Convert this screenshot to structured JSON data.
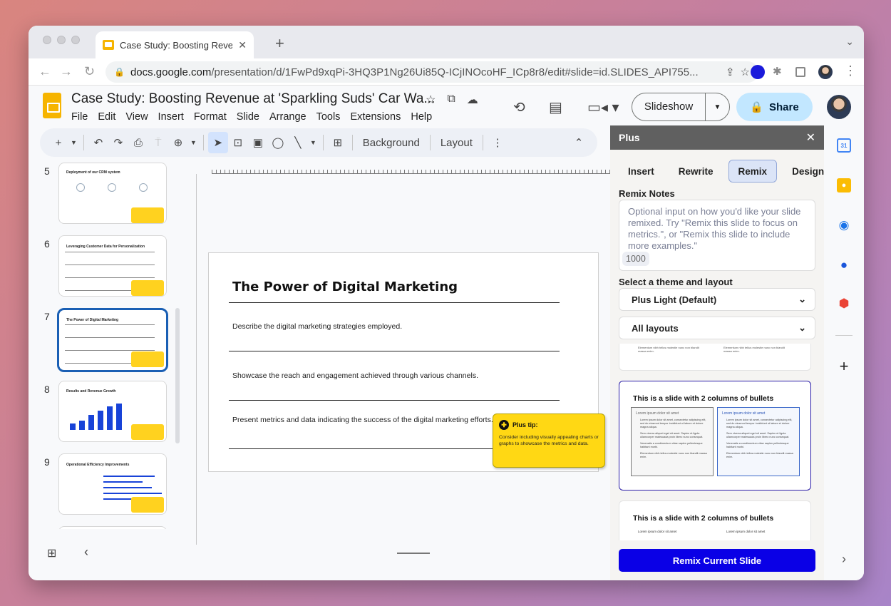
{
  "browser": {
    "tab_title": "Case Study: Boosting Revenue",
    "url_domain": "docs.google.com",
    "url_path": "/presentation/d/1FwPd9xqPi-3HQ3P1Ng26Ui85Q-ICjINOcoHF_ICp8r8/edit#slide=id.SLIDES_API755..."
  },
  "app": {
    "doc_title": "Case Study: Boosting Revenue at 'Sparkling Suds' Car Wa...",
    "menus": [
      "File",
      "Edit",
      "View",
      "Insert",
      "Format",
      "Slide",
      "Arrange",
      "Tools",
      "Extensions",
      "Help"
    ],
    "slideshow_label": "Slideshow",
    "share_label": "Share"
  },
  "toolbar": {
    "background_label": "Background",
    "layout_label": "Layout"
  },
  "filmstrip": {
    "slides": [
      {
        "number": "5",
        "title": "Deployment of our CRM system"
      },
      {
        "number": "6",
        "title": "Leveraging Customer Data for Personalization"
      },
      {
        "number": "7",
        "title": "The Power of Digital Marketing",
        "active": true
      },
      {
        "number": "8",
        "title": "Results and Revenue Growth"
      },
      {
        "number": "9",
        "title": "Operational Efficiency Improvements"
      }
    ]
  },
  "slide": {
    "title": "The Power of Digital Marketing",
    "bullets": [
      "Describe the digital marketing strategies employed.",
      "Showcase the reach and engagement achieved through various channels.",
      "Present metrics and data indicating the success of the digital marketing efforts."
    ],
    "tip": {
      "heading": "Plus tip:",
      "body": "Consider including visually appealing charts or graphs to showcase the metrics and data."
    }
  },
  "panel": {
    "title": "Plus",
    "tabs": [
      "Insert",
      "Rewrite",
      "Remix",
      "Design"
    ],
    "active_tab": "Remix",
    "notes_label": "Remix Notes",
    "notes_placeholder": "Optional input on how you'd like your slide remixed. Try \"Remix this slide to focus on metrics.\", or \"Remix this slide to include more examples.\"",
    "notes_counter": "1000",
    "theme_label": "Select a theme and layout",
    "theme_value": "Plus Light (Default)",
    "layout_value": "All layouts",
    "layouts": [
      {
        "title": "This is a slide with 2 columns of bullets",
        "col_heading": "Lorem ipsum dolor sit amet",
        "bullets": [
          "Lorem ipsum dolor sit amet, consectetur adipiscing elit, sed do eiusmod tempor incididunt ut labore et dolore magna aliqua.",
          "Sem viverra aliquet eget sit amet. Sapien et ligula ullamcorper malesuada proin libero nunc consequat.",
          "Venenatis a condimentum vitae sapien pellentesque habitant morbi.",
          "Elementum nibh tellus molestie nunc non blandit massa enim."
        ]
      },
      {
        "title": "This is a slide with 2 columns of bullets",
        "col_heading": "Lorem ipsum dolor sit amet"
      }
    ],
    "partial_bullet": "Elementum nibh tellus molestie nunc non blandit massa enim.",
    "remix_button": "Remix Current Slide"
  }
}
